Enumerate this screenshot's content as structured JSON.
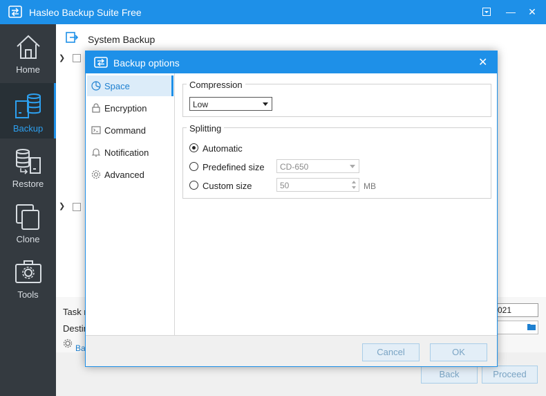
{
  "window": {
    "title": "Hasleo Backup Suite Free",
    "minimize_glyph": "▾",
    "minimize2_glyph": "—",
    "close_glyph": "✕"
  },
  "sidebar": {
    "items": [
      {
        "label": "Home",
        "icon": "home-icon"
      },
      {
        "label": "Backup",
        "icon": "backup-icon",
        "active": true
      },
      {
        "label": "Restore",
        "icon": "restore-icon"
      },
      {
        "label": "Clone",
        "icon": "clone-icon"
      },
      {
        "label": "Tools",
        "icon": "tools-icon"
      }
    ]
  },
  "main": {
    "header_title": "System Backup",
    "task_label": "Task r",
    "task_value": "021",
    "dest_label": "Destin",
    "link_text": "Ba",
    "back_label": "Back",
    "proceed_label": "Proceed"
  },
  "dialog": {
    "title": "Backup options",
    "close_glyph": "✕",
    "nav": [
      {
        "label": "Space",
        "icon": "pie-chart-icon",
        "active": true
      },
      {
        "label": "Encryption",
        "icon": "lock-icon"
      },
      {
        "label": "Command",
        "icon": "terminal-icon"
      },
      {
        "label": "Notification",
        "icon": "bell-icon"
      },
      {
        "label": "Advanced",
        "icon": "gear-icon"
      }
    ],
    "compression": {
      "group_title": "Compression",
      "selected": "Low"
    },
    "splitting": {
      "group_title": "Splitting",
      "automatic_label": "Automatic",
      "predefined_label": "Predefined size",
      "predefined_value": "CD-650",
      "custom_label": "Custom size",
      "custom_value": "50",
      "custom_unit": "MB",
      "selected": "automatic"
    },
    "cancel_label": "Cancel",
    "ok_label": "OK"
  },
  "colors": {
    "accent": "#1e90e8",
    "sidebar_bg": "#343a40",
    "active_text": "#2da0f0"
  }
}
